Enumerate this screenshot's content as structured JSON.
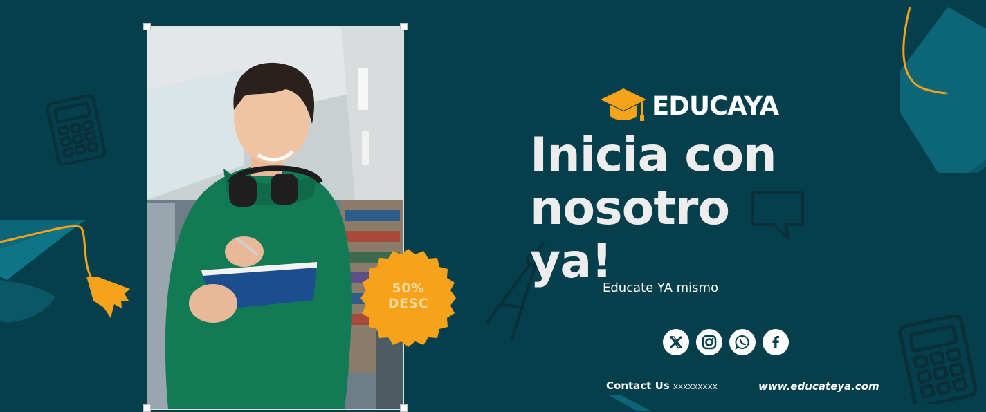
{
  "brand": {
    "name": "EDUCAYA"
  },
  "headline": {
    "line1": "Inicia con",
    "line2": "nosotro",
    "line3": "ya!"
  },
  "tagline": "Educate YA mismo",
  "badge": {
    "line1": "50%",
    "line2": "DESC"
  },
  "contact": {
    "label": "Contact Us",
    "value": "xxxxxxxxx"
  },
  "website": "www.educateya.com",
  "socials": [
    "x-icon",
    "instagram-icon",
    "whatsapp-icon",
    "facebook-icon"
  ],
  "colors": {
    "background": "#053f4b",
    "accent": "#f6a21a",
    "teal": "#0a6b7c",
    "hoodie": "#127a55"
  }
}
